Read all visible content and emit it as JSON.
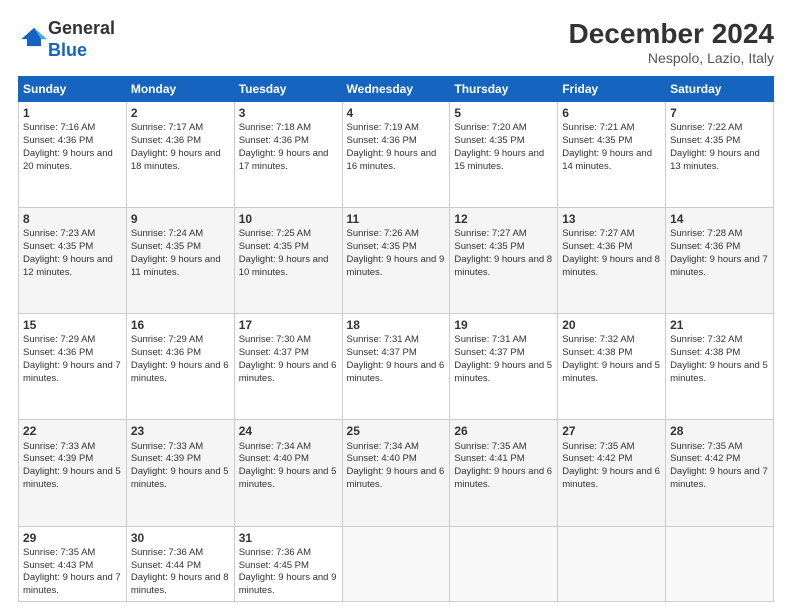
{
  "header": {
    "logo_line1": "General",
    "logo_line2": "Blue",
    "month_year": "December 2024",
    "location": "Nespolo, Lazio, Italy"
  },
  "days_of_week": [
    "Sunday",
    "Monday",
    "Tuesday",
    "Wednesday",
    "Thursday",
    "Friday",
    "Saturday"
  ],
  "weeks": [
    [
      {
        "day": 1,
        "sunrise": "7:16 AM",
        "sunset": "4:36 PM",
        "daylight": "9 hours and 20 minutes."
      },
      {
        "day": 2,
        "sunrise": "7:17 AM",
        "sunset": "4:36 PM",
        "daylight": "9 hours and 18 minutes."
      },
      {
        "day": 3,
        "sunrise": "7:18 AM",
        "sunset": "4:36 PM",
        "daylight": "9 hours and 17 minutes."
      },
      {
        "day": 4,
        "sunrise": "7:19 AM",
        "sunset": "4:36 PM",
        "daylight": "9 hours and 16 minutes."
      },
      {
        "day": 5,
        "sunrise": "7:20 AM",
        "sunset": "4:35 PM",
        "daylight": "9 hours and 15 minutes."
      },
      {
        "day": 6,
        "sunrise": "7:21 AM",
        "sunset": "4:35 PM",
        "daylight": "9 hours and 14 minutes."
      },
      {
        "day": 7,
        "sunrise": "7:22 AM",
        "sunset": "4:35 PM",
        "daylight": "9 hours and 13 minutes."
      }
    ],
    [
      {
        "day": 8,
        "sunrise": "7:23 AM",
        "sunset": "4:35 PM",
        "daylight": "9 hours and 12 minutes."
      },
      {
        "day": 9,
        "sunrise": "7:24 AM",
        "sunset": "4:35 PM",
        "daylight": "9 hours and 11 minutes."
      },
      {
        "day": 10,
        "sunrise": "7:25 AM",
        "sunset": "4:35 PM",
        "daylight": "9 hours and 10 minutes."
      },
      {
        "day": 11,
        "sunrise": "7:26 AM",
        "sunset": "4:35 PM",
        "daylight": "9 hours and 9 minutes."
      },
      {
        "day": 12,
        "sunrise": "7:27 AM",
        "sunset": "4:35 PM",
        "daylight": "9 hours and 8 minutes."
      },
      {
        "day": 13,
        "sunrise": "7:27 AM",
        "sunset": "4:36 PM",
        "daylight": "9 hours and 8 minutes."
      },
      {
        "day": 14,
        "sunrise": "7:28 AM",
        "sunset": "4:36 PM",
        "daylight": "9 hours and 7 minutes."
      }
    ],
    [
      {
        "day": 15,
        "sunrise": "7:29 AM",
        "sunset": "4:36 PM",
        "daylight": "9 hours and 7 minutes."
      },
      {
        "day": 16,
        "sunrise": "7:29 AM",
        "sunset": "4:36 PM",
        "daylight": "9 hours and 6 minutes."
      },
      {
        "day": 17,
        "sunrise": "7:30 AM",
        "sunset": "4:37 PM",
        "daylight": "9 hours and 6 minutes."
      },
      {
        "day": 18,
        "sunrise": "7:31 AM",
        "sunset": "4:37 PM",
        "daylight": "9 hours and 6 minutes."
      },
      {
        "day": 19,
        "sunrise": "7:31 AM",
        "sunset": "4:37 PM",
        "daylight": "9 hours and 5 minutes."
      },
      {
        "day": 20,
        "sunrise": "7:32 AM",
        "sunset": "4:38 PM",
        "daylight": "9 hours and 5 minutes."
      },
      {
        "day": 21,
        "sunrise": "7:32 AM",
        "sunset": "4:38 PM",
        "daylight": "9 hours and 5 minutes."
      }
    ],
    [
      {
        "day": 22,
        "sunrise": "7:33 AM",
        "sunset": "4:39 PM",
        "daylight": "9 hours and 5 minutes."
      },
      {
        "day": 23,
        "sunrise": "7:33 AM",
        "sunset": "4:39 PM",
        "daylight": "9 hours and 5 minutes."
      },
      {
        "day": 24,
        "sunrise": "7:34 AM",
        "sunset": "4:40 PM",
        "daylight": "9 hours and 5 minutes."
      },
      {
        "day": 25,
        "sunrise": "7:34 AM",
        "sunset": "4:40 PM",
        "daylight": "9 hours and 6 minutes."
      },
      {
        "day": 26,
        "sunrise": "7:35 AM",
        "sunset": "4:41 PM",
        "daylight": "9 hours and 6 minutes."
      },
      {
        "day": 27,
        "sunrise": "7:35 AM",
        "sunset": "4:42 PM",
        "daylight": "9 hours and 6 minutes."
      },
      {
        "day": 28,
        "sunrise": "7:35 AM",
        "sunset": "4:42 PM",
        "daylight": "9 hours and 7 minutes."
      }
    ],
    [
      {
        "day": 29,
        "sunrise": "7:35 AM",
        "sunset": "4:43 PM",
        "daylight": "9 hours and 7 minutes."
      },
      {
        "day": 30,
        "sunrise": "7:36 AM",
        "sunset": "4:44 PM",
        "daylight": "9 hours and 8 minutes."
      },
      {
        "day": 31,
        "sunrise": "7:36 AM",
        "sunset": "4:45 PM",
        "daylight": "9 hours and 9 minutes."
      },
      null,
      null,
      null,
      null
    ]
  ]
}
